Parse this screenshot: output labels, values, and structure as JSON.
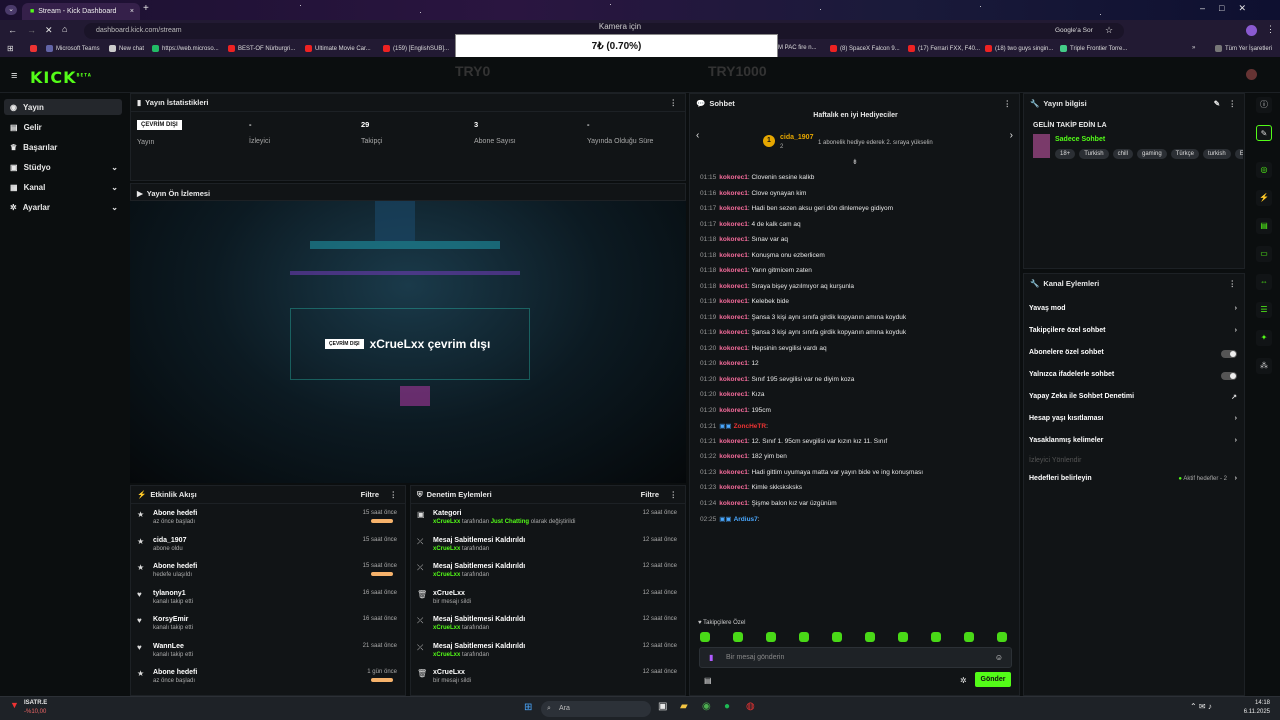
{
  "browser": {
    "tab_title": "Stream - Kick Dashboard",
    "url": "dashboard.kick.com/stream",
    "google_btn": "Google'a Sor",
    "bookmarks": [
      "Microsoft Teams",
      "New chat",
      "https://web.microso...",
      "BEST-OF Nürburgri...",
      "Ultimate Movie Car...",
      "(159) [EnglishSUB]...",
      "M PAC fire n...",
      "(8) SpaceX Falcon 9...",
      "(17) Ferrari FXX, F40...",
      "(18) two guys singin...",
      "Triple Frontier Torre..."
    ],
    "all_bookmarks": "Tüm Yer İşaretleri"
  },
  "overlay": {
    "top_label": "Kamera için",
    "amount": "7₺ (0.70%)",
    "left_ghost": "TRY0",
    "right_ghost": "TRY1000"
  },
  "brand": {
    "logo": "KICK",
    "beta": "BETA",
    "accent": "#53fc18"
  },
  "sidebar": {
    "items": [
      {
        "label": "Yayın",
        "icon": "broadcast-icon",
        "active": true
      },
      {
        "label": "Gelir",
        "icon": "wallet-icon"
      },
      {
        "label": "Başarılar",
        "icon": "trophy-icon"
      },
      {
        "label": "Stüdyo",
        "icon": "studio-icon"
      },
      {
        "label": "Kanal",
        "icon": "channel-icon"
      },
      {
        "label": "Ayarlar",
        "icon": "gear-icon"
      }
    ]
  },
  "stats": {
    "title": "Yayın İstatistikleri",
    "items": [
      {
        "value": "ÇEVRİM DIŞI",
        "label": "Yayın"
      },
      {
        "value": "-",
        "label": "İzleyici"
      },
      {
        "value": "29",
        "label": "Takipçi"
      },
      {
        "value": "3",
        "label": "Abone Sayısı"
      },
      {
        "value": "-",
        "label": "Yayında Olduğu Süre"
      }
    ]
  },
  "preview": {
    "title": "Yayın Ön İzlemesi",
    "badge": "ÇEVRİM DIŞI",
    "text": "xCrueLxx çevrim dışı"
  },
  "activity": {
    "title": "Etkinlik Akışı",
    "filter": "Filtre",
    "items": [
      {
        "title": "Abone hedefi",
        "sub": "az önce başladı",
        "ago": "15 saat önce",
        "icon": "star-icon"
      },
      {
        "title": "cida_1907",
        "sub": "abone oldu",
        "ago": "15 saat önce",
        "icon": "star-icon"
      },
      {
        "title": "Abone hedefi",
        "sub": "hedefe ulaşıldı",
        "ago": "15 saat önce",
        "icon": "star-icon"
      },
      {
        "title": "tylanony1",
        "sub": "kanalı takip etti",
        "ago": "16 saat önce",
        "icon": "heart-icon"
      },
      {
        "title": "KorsyEmir",
        "sub": "kanalı takip etti",
        "ago": "16 saat önce",
        "icon": "heart-icon"
      },
      {
        "title": "WannLee",
        "sub": "kanalı takip etti",
        "ago": "21 saat önce",
        "icon": "heart-icon"
      },
      {
        "title": "Abone hedefi",
        "sub": "az önce başladı",
        "ago": "1 gün önce",
        "icon": "star-icon"
      }
    ]
  },
  "moderation": {
    "title": "Denetim Eylemleri",
    "filter": "Filtre",
    "items": [
      {
        "title": "Kategori",
        "user": "xCrueLxx",
        "mid": " tarafından ",
        "cat": "Just Chatting",
        "tail": " olarak değiştirildi",
        "ago": "12 saat önce",
        "icon": "category-icon"
      },
      {
        "title": "Mesaj Sabitlemesi Kaldırıldı",
        "user": "xCrueLxx",
        "mid": " tarafından",
        "cat": "",
        "tail": "",
        "ago": "12 saat önce",
        "icon": "unpin-icon"
      },
      {
        "title": "Mesaj Sabitlemesi Kaldırıldı",
        "user": "xCrueLxx",
        "mid": " tarafından",
        "cat": "",
        "tail": "",
        "ago": "12 saat önce",
        "icon": "unpin-icon"
      },
      {
        "title": "xCrueLxx",
        "user": "",
        "mid": "bir mesajı sildi",
        "cat": "",
        "tail": "",
        "ago": "12 saat önce",
        "icon": "trash-icon"
      },
      {
        "title": "Mesaj Sabitlemesi Kaldırıldı",
        "user": "xCrueLxx",
        "mid": " tarafından",
        "cat": "",
        "tail": "",
        "ago": "12 saat önce",
        "icon": "unpin-icon"
      },
      {
        "title": "Mesaj Sabitlemesi Kaldırıldı",
        "user": "xCrueLxx",
        "mid": " tarafından",
        "cat": "",
        "tail": "",
        "ago": "12 saat önce",
        "icon": "unpin-icon"
      },
      {
        "title": "xCrueLxx",
        "user": "",
        "mid": "bir mesajı sildi",
        "cat": "",
        "tail": "",
        "ago": "12 saat önce",
        "icon": "trash-icon"
      }
    ]
  },
  "chat": {
    "title": "Sohbet",
    "gifter_title": "Haftalık en iyi Hediyeciler",
    "gifter_name": "cida_1907",
    "gifter_count": "2",
    "gifter_hint": "1 abonelik hediye ederek 2. sıraya yükselin",
    "messages": [
      {
        "t": "01:15",
        "u": "kokorec1",
        "m": ": Clovenin sesine kalkb"
      },
      {
        "t": "01:16",
        "u": "kokorec1",
        "m": ": Clove oynayan kim"
      },
      {
        "t": "01:17",
        "u": "kokorec1",
        "m": ": Hadi ben sezen aksu geri dön dinlemeye gidiyom"
      },
      {
        "t": "01:17",
        "u": "kokorec1",
        "m": ": 4 de kalk cam aq"
      },
      {
        "t": "01:18",
        "u": "kokorec1",
        "m": ": Sınav var aq"
      },
      {
        "t": "01:18",
        "u": "kokorec1",
        "m": ": Konuşma onu ezberlicem"
      },
      {
        "t": "01:18",
        "u": "kokorec1",
        "m": ": Yarın gitmicem zaten"
      },
      {
        "t": "01:18",
        "u": "kokorec1",
        "m": ": Sıraya bişey yazılmıyor aq kurşunla"
      },
      {
        "t": "01:19",
        "u": "kokorec1",
        "m": ": Kelebek bide"
      },
      {
        "t": "01:19",
        "u": "kokorec1",
        "m": ": Şansa 3 kişi aynı sınıfa girdik kopyanın amına koyduk"
      },
      {
        "t": "01:19",
        "u": "kokorec1",
        "m": ": Şansa 3 kişi aynı sınıfa girdik kopyanın amına koyduk"
      },
      {
        "t": "01:20",
        "u": "kokorec1",
        "m": ": Hepsinin sevgilisi vardı aq"
      },
      {
        "t": "01:20",
        "u": "kokorec1",
        "m": ": 12"
      },
      {
        "t": "01:20",
        "u": "kokorec1",
        "m": ": Sınıf 195 sevgilisi var ne diyim koza"
      },
      {
        "t": "01:20",
        "u": "kokorec1",
        "m": ": Kıza"
      },
      {
        "t": "01:20",
        "u": "kokorec1",
        "m": ": 195cm"
      },
      {
        "t": "01:21",
        "u": "ZoncHeTR",
        "m": ":"
      },
      {
        "t": "01:21",
        "u": "kokorec1",
        "m": ": 12. Sınıf 1. 95cm sevgilisi var kızın kız 11. Sınıf"
      },
      {
        "t": "01:22",
        "u": "kokorec1",
        "m": ": 182 yim ben"
      },
      {
        "t": "01:23",
        "u": "kokorec1",
        "m": ": Hadi gittim uyumaya matta var yayın bide ve ing konuşması"
      },
      {
        "t": "01:23",
        "u": "kokorec1",
        "m": ": Kimle skksksksks"
      },
      {
        "t": "01:24",
        "u": "kokorec1",
        "m": ": Şişme balon kız var üzgünüm"
      },
      {
        "t": "02:25",
        "u": "Ardius7",
        "m": ":"
      }
    ],
    "followers_only": "Takipçilere Özel",
    "placeholder": "Bir mesaj gönderin",
    "send": "Gönder"
  },
  "stream_info": {
    "title": "Yayın bilgisi",
    "heading": "GELİN TAKİP EDİN LA",
    "category": "Sadece Sohbet",
    "tags": [
      "18+",
      "Turkish",
      "chill",
      "gaming",
      "Türkçe",
      "turkish",
      "E"
    ]
  },
  "channel_actions": {
    "title": "Kanal Eylemleri",
    "items": [
      {
        "label": "Yavaş mod",
        "type": "arrow"
      },
      {
        "label": "Takipçilere özel sohbet",
        "type": "arrow"
      },
      {
        "label": "Abonelere özel sohbet",
        "type": "toggle"
      },
      {
        "label": "Yalnızca ifadelerle sohbet",
        "type": "toggle"
      },
      {
        "label": "Yapay Zeka ile Sohbet Denetimi",
        "type": "ext"
      },
      {
        "label": "Hesap yaşı kısıtlaması",
        "type": "arrow"
      },
      {
        "label": "Yasaklanmış kelimeler",
        "type": "arrow"
      }
    ],
    "section": "İzleyici Yönlendir",
    "goals_label": "Hedefleri belirleyin",
    "goals_status": "Aktif hedefler - 2"
  },
  "taskbar": {
    "stock_name": "ISATR.E",
    "stock_change": "-%10,00",
    "search": "Ara",
    "time": "14:18",
    "date": "6.11.2025"
  }
}
